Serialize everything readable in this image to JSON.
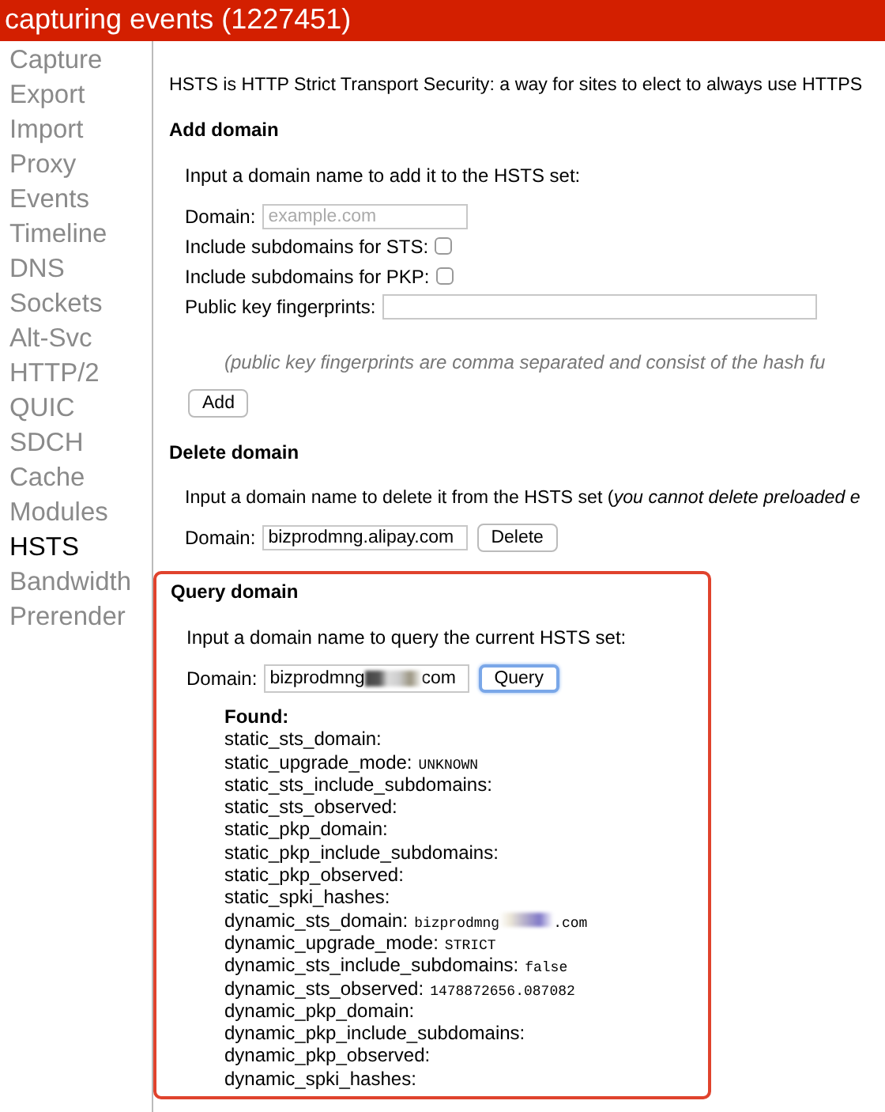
{
  "title": "capturing events (1227451)",
  "sidebar": {
    "items": [
      {
        "label": "Capture",
        "selected": false
      },
      {
        "label": "Export",
        "selected": false
      },
      {
        "label": "Import",
        "selected": false
      },
      {
        "label": "Proxy",
        "selected": false
      },
      {
        "label": "Events",
        "selected": false
      },
      {
        "label": "Timeline",
        "selected": false
      },
      {
        "label": "DNS",
        "selected": false
      },
      {
        "label": "Sockets",
        "selected": false
      },
      {
        "label": "Alt-Svc",
        "selected": false
      },
      {
        "label": "HTTP/2",
        "selected": false
      },
      {
        "label": "QUIC",
        "selected": false
      },
      {
        "label": "SDCH",
        "selected": false
      },
      {
        "label": "Cache",
        "selected": false
      },
      {
        "label": "Modules",
        "selected": false
      },
      {
        "label": "HSTS",
        "selected": true
      },
      {
        "label": "Bandwidth",
        "selected": false
      },
      {
        "label": "Prerender",
        "selected": false
      }
    ]
  },
  "intro": "HSTS is HTTP Strict Transport Security: a way for sites to elect to always use HTTPS",
  "add_domain": {
    "heading": "Add domain",
    "description": "Input a domain name to add it to the HSTS set:",
    "domain_label": "Domain:",
    "domain_placeholder": "example.com",
    "checkboxes": [
      {
        "label": "Include subdomains for STS:",
        "checked": false
      },
      {
        "label": "Include subdomains for PKP:",
        "checked": false
      }
    ],
    "fingerprints_label": "Public key fingerprints:",
    "note": "(public key fingerprints are comma separated and consist of the hash fu",
    "button": "Add"
  },
  "delete_domain": {
    "heading": "Delete domain",
    "description": "Input a domain name to delete it from the HSTS set (*you cannot delete preloaded e*",
    "domain_label": "Domain:",
    "domain_value": "bizprodmng.alipay.com",
    "button": "Delete"
  },
  "query_domain": {
    "heading": "Query domain",
    "description": "Input a domain name to query the current HSTS set:",
    "domain_label": "Domain:",
    "domain_value": "bizprodmng",
    "domain_value_end": "com",
    "redacted": true,
    "button": "Query",
    "button_focused": true,
    "result_heading": "Found:",
    "results": [
      {
        "key": "static_sts_domain:"
      },
      {
        "key": "static_upgrade_mode:",
        "value": "UNKNOWN"
      },
      {
        "key": "static_sts_include_subdomains:"
      },
      {
        "key": "static_sts_observed:"
      },
      {
        "key": "static_pkp_domain:"
      },
      {
        "key": "static_pkp_include_subdomains:"
      },
      {
        "key": "static_pkp_observed:"
      },
      {
        "key": "static_spki_hashes:"
      },
      {
        "key": "dynamic_sts_domain:",
        "value": "bizprodmng",
        "value_end": ".com",
        "redacted": true
      },
      {
        "key": "dynamic_upgrade_mode:",
        "value": "STRICT"
      },
      {
        "key": "dynamic_sts_include_subdomains:",
        "value": "false"
      },
      {
        "key": "dynamic_sts_observed:",
        "value": "1478872656.087082"
      },
      {
        "key": "dynamic_pkp_domain:"
      },
      {
        "key": "dynamic_pkp_include_subdomains:"
      },
      {
        "key": "dynamic_pkp_observed:"
      },
      {
        "key": "dynamic_spki_hashes:"
      }
    ]
  }
}
